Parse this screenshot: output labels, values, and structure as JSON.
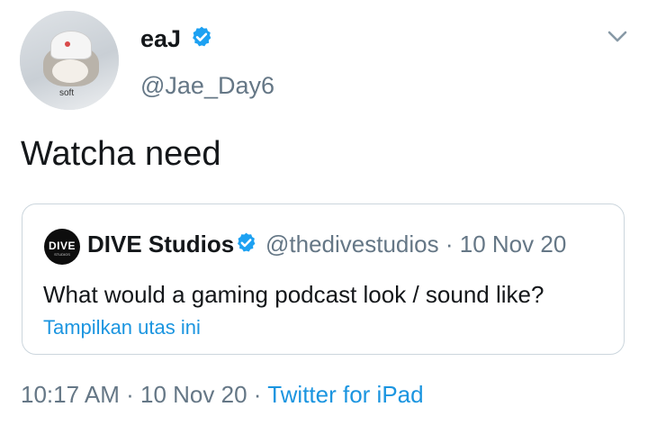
{
  "author": {
    "name": "eaJ",
    "handle": "@Jae_Day6",
    "avatar_caption": "soft",
    "verified": true
  },
  "tweet": {
    "text": "Watcha need"
  },
  "quoted": {
    "logo_text": "DIVE",
    "logo_subtext": "STUDIOS",
    "name": "DIVE Studios",
    "verified": true,
    "handle": "@thedivestudios",
    "separator": "·",
    "date": "10 Nov 20",
    "text": "What would a gaming podcast look / sound like?",
    "thread_link": "Tampilkan utas ini"
  },
  "footer": {
    "time": "10:17 AM",
    "sep1": "·",
    "date": "10 Nov 20",
    "sep2": "·",
    "source": "Twitter for iPad"
  },
  "colors": {
    "link": "#1b95e0",
    "verified": "#1da1f2",
    "secondary_text": "#657786",
    "border": "#ccd6dd"
  },
  "icons": {
    "verified": "verified-badge-icon",
    "menu": "chevron-down-icon"
  }
}
